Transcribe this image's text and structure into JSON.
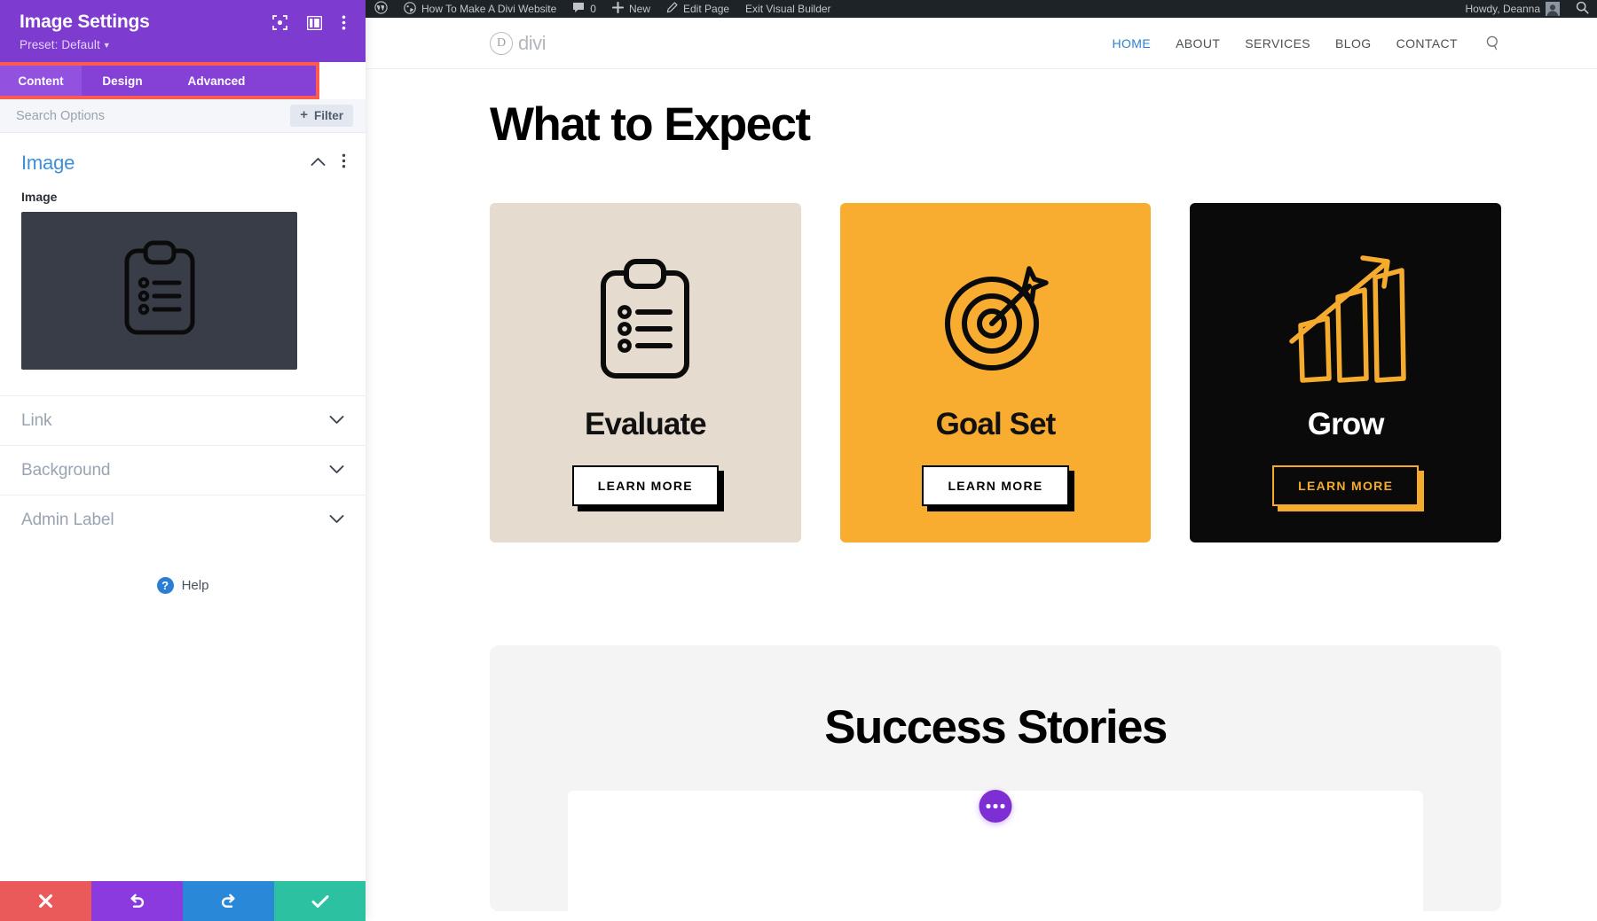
{
  "settings_panel": {
    "title": "Image Settings",
    "preset_label": "Preset: Default",
    "header_icons": [
      {
        "name": "focus-target-icon"
      },
      {
        "name": "layout-columns-icon"
      },
      {
        "name": "kebab-menu-icon"
      }
    ],
    "tabs": [
      {
        "label": "Content",
        "active": true
      },
      {
        "label": "Design",
        "active": false
      },
      {
        "label": "Advanced",
        "active": false
      }
    ],
    "search": {
      "placeholder": "Search Options",
      "value": ""
    },
    "filter_button": {
      "label": "Filter",
      "plus": "+"
    },
    "image_section": {
      "title": "Image",
      "field_label": "Image",
      "preview_icon": "clipboard-checklist-icon",
      "preview_bg": "#383d47"
    },
    "accordions": [
      {
        "label": "Link"
      },
      {
        "label": "Background"
      },
      {
        "label": "Admin Label"
      }
    ],
    "help": {
      "label": "Help",
      "badge": "?"
    },
    "actions": [
      {
        "name": "cancel-button",
        "icon": "close-icon",
        "color": "#eb5a5a"
      },
      {
        "name": "undo-button",
        "icon": "undo-icon",
        "color": "#8b3ae0"
      },
      {
        "name": "redo-button",
        "icon": "redo-icon",
        "color": "#2a88d8"
      },
      {
        "name": "save-button",
        "icon": "check-icon",
        "color": "#2cc1a0"
      }
    ],
    "highlight_color": "#fd5a52",
    "header_bg": "#7e3bd0",
    "tabbar_bg": "#8540d6"
  },
  "admin_bar": {
    "logo": "wordpress-logo-icon",
    "site_name": "How To Make A Divi Website",
    "comments_count": "0",
    "new_label": "New",
    "edit_page_label": "Edit Page",
    "exit_builder_label": "Exit Visual Builder",
    "howdy": "Howdy, Deanna",
    "search_icon": "search-icon"
  },
  "site": {
    "brand": {
      "mark": "D",
      "text": "divi"
    },
    "nav": [
      {
        "label": "HOME",
        "active": true
      },
      {
        "label": "ABOUT",
        "active": false
      },
      {
        "label": "SERVICES",
        "active": false
      },
      {
        "label": "BLOG",
        "active": false
      },
      {
        "label": "CONTACT",
        "active": false
      }
    ],
    "nav_search_icon": "search-icon",
    "heading": "What to Expect",
    "cards": [
      {
        "title": "Evaluate",
        "button": "LEARN MORE",
        "icon": "clipboard-checklist-icon",
        "bg": "#e5dbce",
        "style": "beige"
      },
      {
        "title": "Goal Set",
        "button": "LEARN MORE",
        "icon": "target-dart-icon",
        "bg": "#f9ad30",
        "style": "orange"
      },
      {
        "title": "Grow",
        "button": "LEARN MORE",
        "icon": "bar-chart-growth-icon",
        "bg": "#0a0a0a",
        "style": "black"
      }
    ],
    "success_heading": "Success Stories",
    "fab": {
      "name": "module-options-fab",
      "icon": "ellipsis-icon"
    }
  }
}
